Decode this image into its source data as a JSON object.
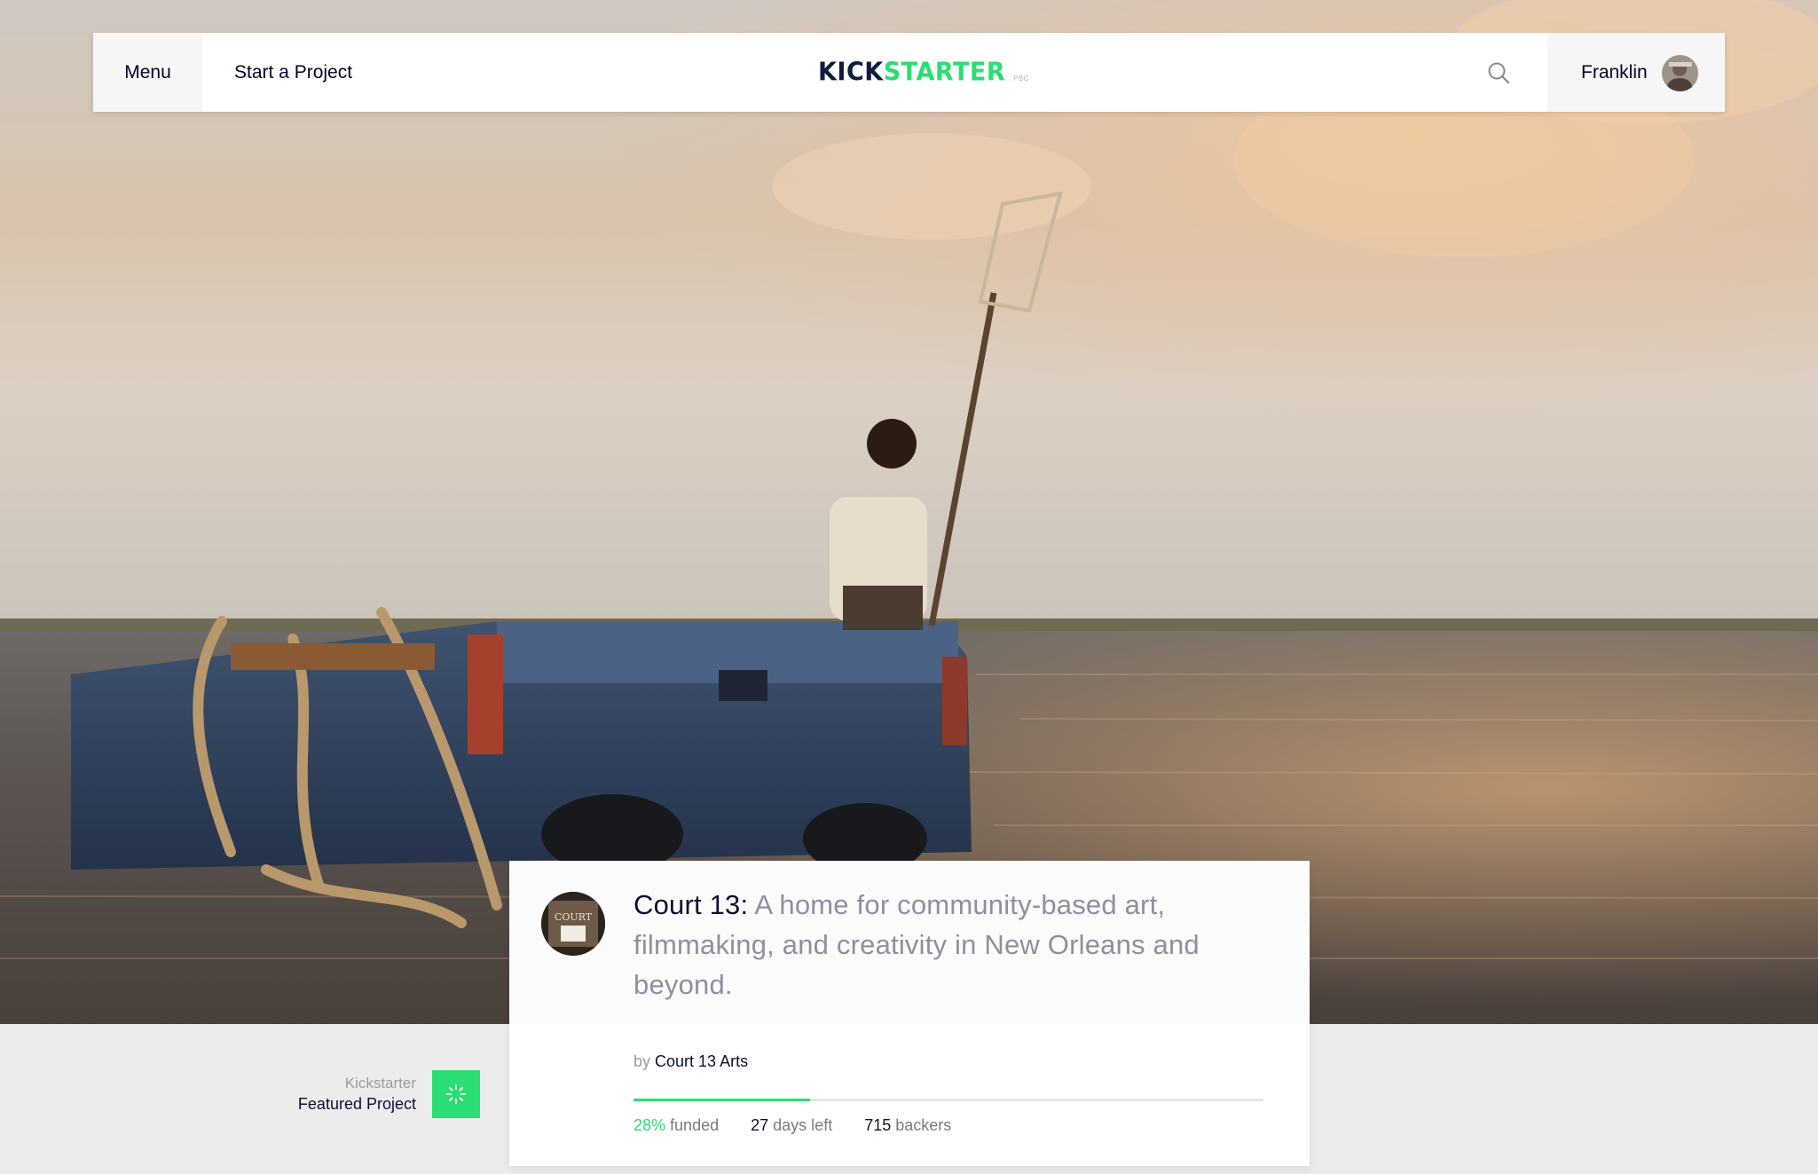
{
  "nav": {
    "menu_label": "Menu",
    "start_label": "Start a Project",
    "logo_kick": "KICK",
    "logo_starter": "STARTER",
    "logo_suffix": "PBC",
    "search_icon": "search-icon",
    "user_name": "Franklin"
  },
  "project": {
    "name": "Court 13:",
    "blurb": "A home for community-based art, filmmaking, and creativity in New Orleans and beyond.",
    "by_prefix": "by",
    "creator": "Court 13 Arts",
    "logo_text": "COURT",
    "funded_percent": 28,
    "funded_value": "28%",
    "funded_label": "funded",
    "days_value": "27",
    "days_label": "days left",
    "backers_value": "715",
    "backers_label": "backers"
  },
  "featured": {
    "line1": "Kickstarter",
    "line2": "Featured Project"
  },
  "colors": {
    "brand_green": "#2bde73",
    "brand_navy": "#0f1b3c"
  }
}
